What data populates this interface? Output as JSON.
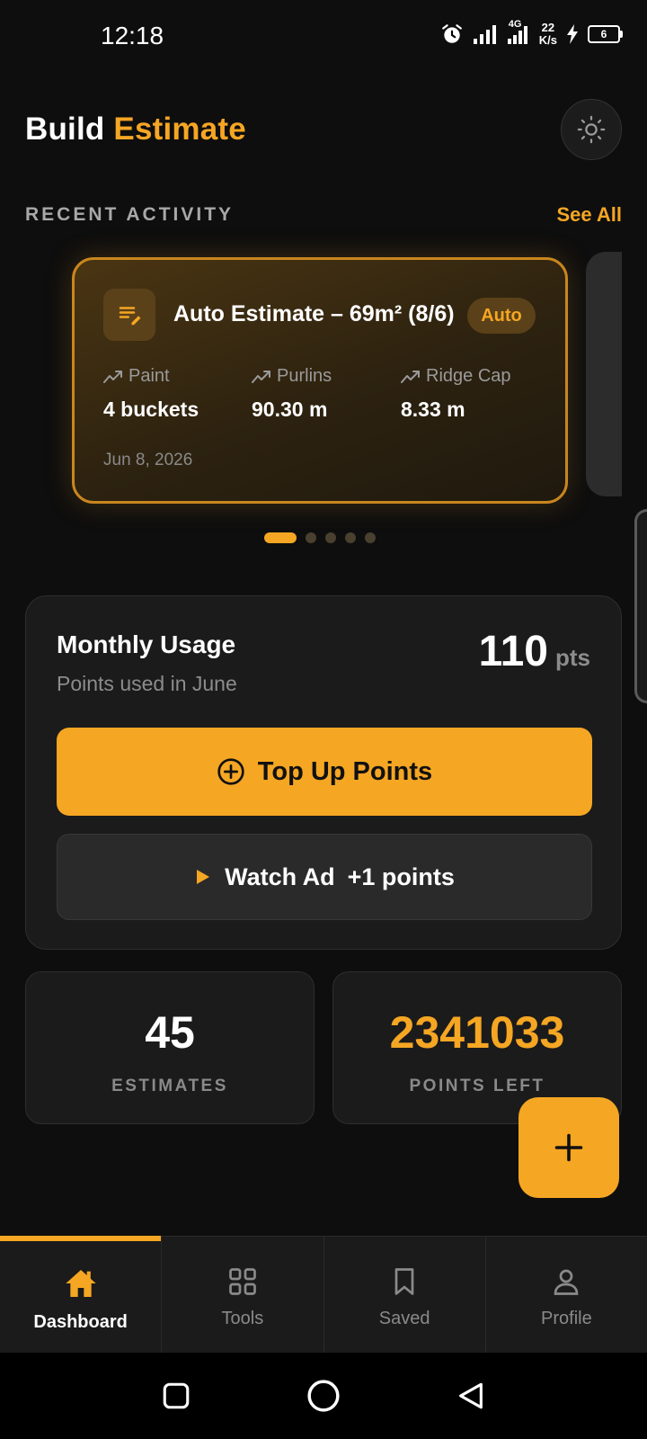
{
  "status_bar": {
    "time": "12:18",
    "network_type": "4G",
    "net_speed_value": "22",
    "net_speed_unit": "K/s",
    "battery": "6"
  },
  "header": {
    "title_part1": "Build",
    "title_part2": "Estimate"
  },
  "recent_activity": {
    "section_title": "RECENT ACTIVITY",
    "see_all_label": "See All",
    "cards": [
      {
        "title": "Auto Estimate – 69m² (8/6)",
        "badge": "Auto",
        "metrics": [
          {
            "label": "Paint",
            "value": "4 buckets"
          },
          {
            "label": "Purlins",
            "value": "90.30 m"
          },
          {
            "label": "Ridge Cap",
            "value": "8.33 m"
          }
        ],
        "date": "Jun 8, 2026"
      }
    ],
    "page_count": 5,
    "active_page": 1
  },
  "monthly_usage": {
    "title": "Monthly Usage",
    "subtitle": "Points used in June",
    "points_value": "110",
    "points_unit": "pts",
    "topup_label": "Top Up Points",
    "watch_ad_label": "Watch Ad",
    "watch_ad_reward": "+1 points"
  },
  "stats": [
    {
      "value": "45",
      "label": "ESTIMATES"
    },
    {
      "value": "2341033",
      "label": "POINTS LEFT"
    }
  ],
  "bottom_nav": {
    "items": [
      {
        "label": "Dashboard",
        "icon": "home-icon",
        "active": true
      },
      {
        "label": "Tools",
        "icon": "grid-icon",
        "active": false
      },
      {
        "label": "Saved",
        "icon": "bookmark-icon",
        "active": false
      },
      {
        "label": "Profile",
        "icon": "user-icon",
        "active": false
      }
    ]
  },
  "colors": {
    "accent": "#f5a623",
    "background": "#0e0e0e",
    "card": "#1b1b1b",
    "muted_text": "#8a8a8a"
  }
}
